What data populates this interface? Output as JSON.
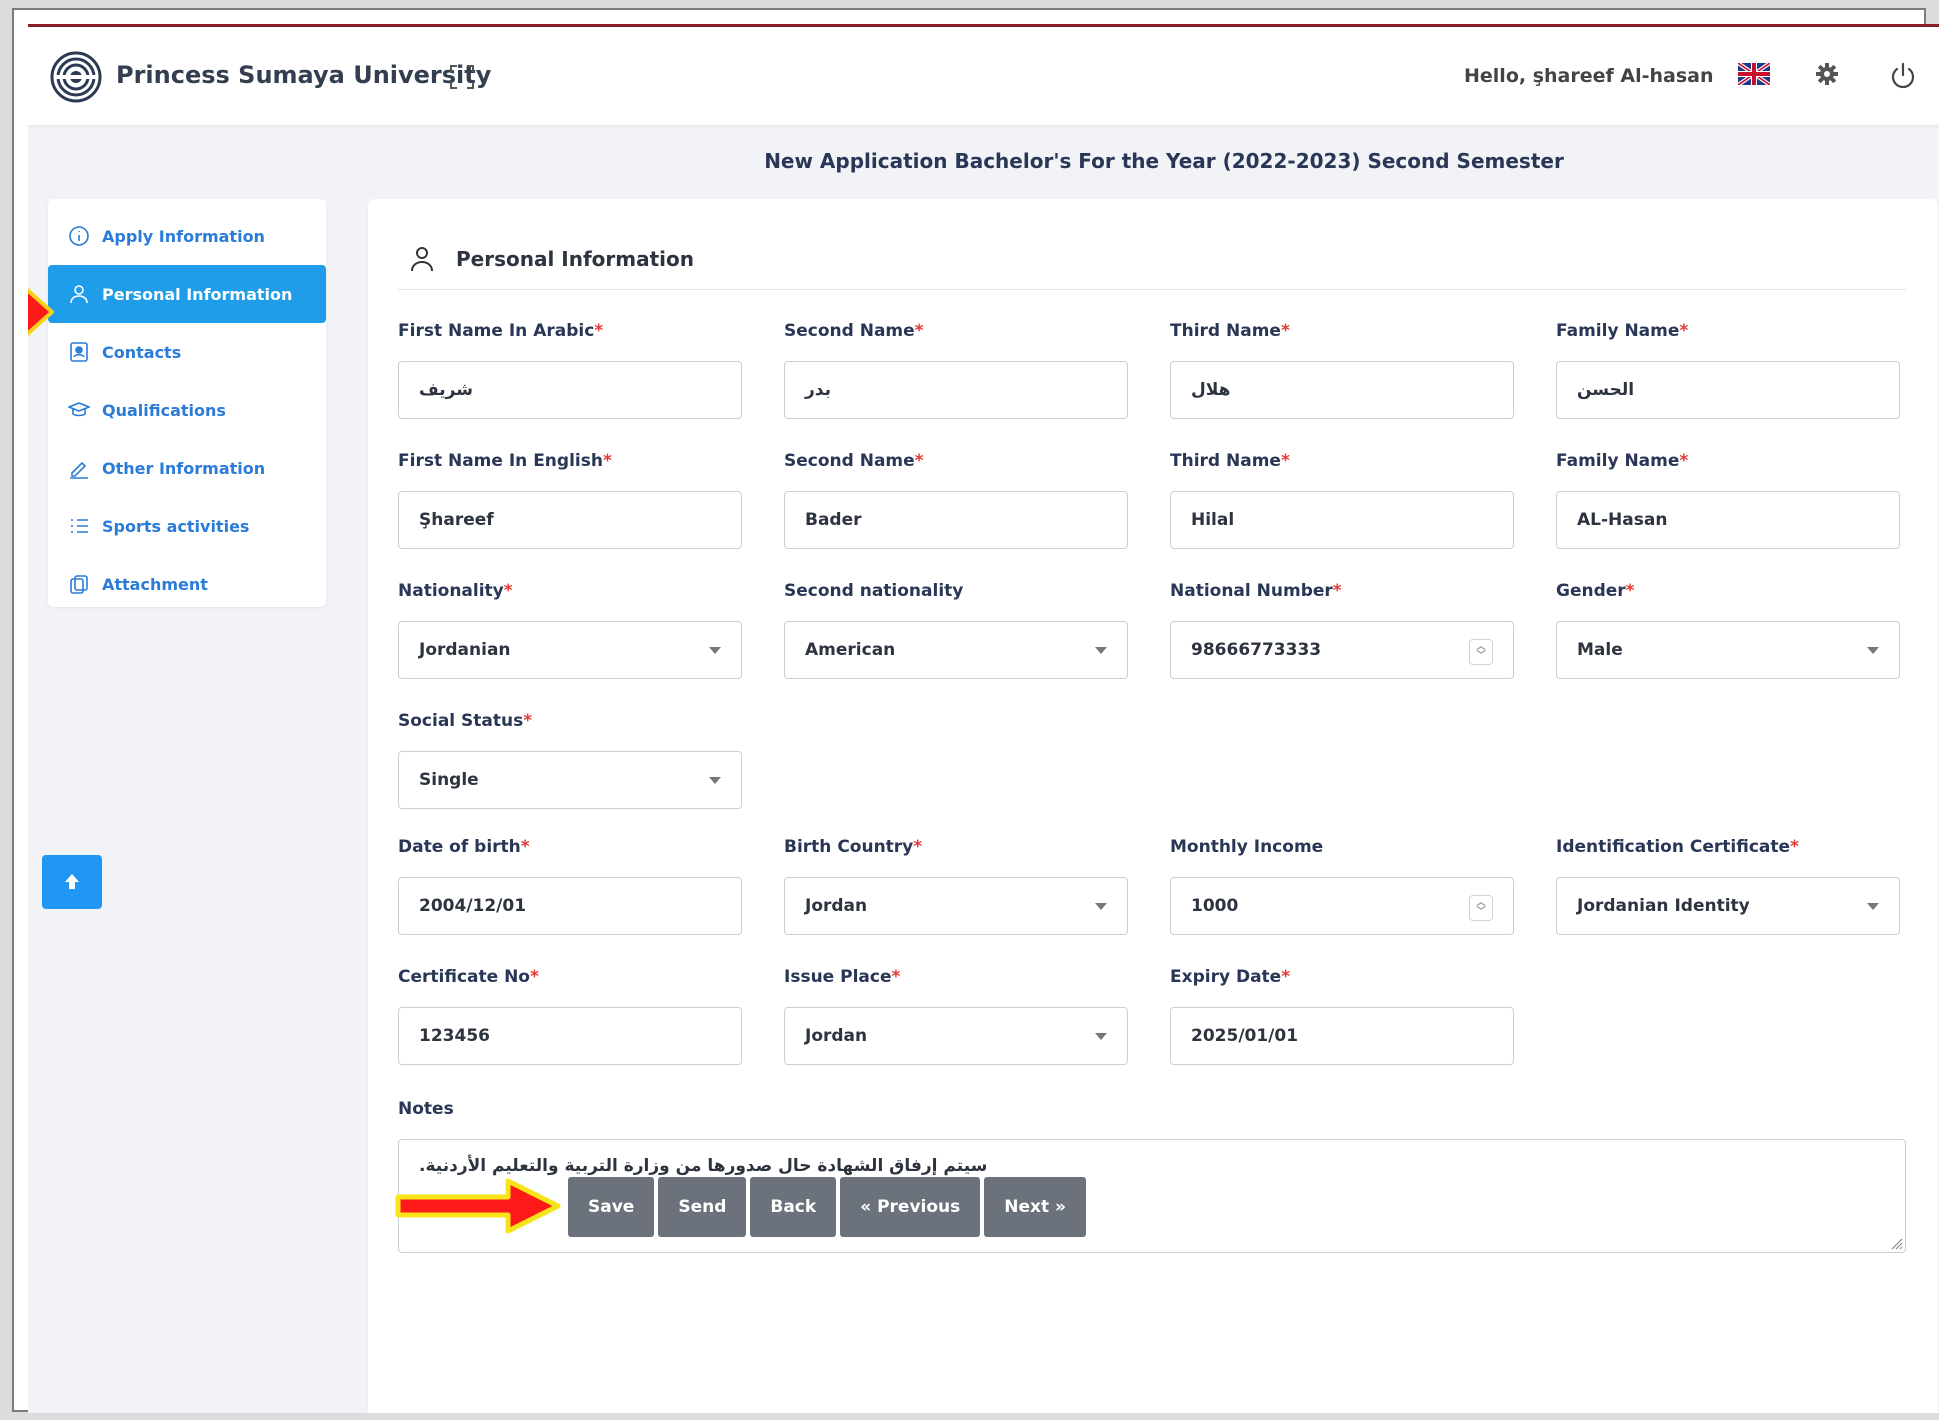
{
  "header": {
    "university_name": "Princess Sumaya University",
    "greeting": "Hello, şhareef Al-hasan",
    "icons": [
      "university-logo-icon",
      "expand-icon",
      "uk-flag-icon",
      "gear-icon",
      "power-icon"
    ]
  },
  "page_title": "New Application Bachelor's For the Year (2022-2023) Second Semester",
  "sidebar": {
    "items": [
      {
        "label": "Apply Information",
        "icon": "info-icon",
        "active": false
      },
      {
        "label": "Personal Information",
        "icon": "user-icon",
        "active": true
      },
      {
        "label": "Contacts",
        "icon": "contact-card-icon",
        "active": false
      },
      {
        "label": "Qualifications",
        "icon": "graduation-cap-icon",
        "active": false
      },
      {
        "label": "Other Information",
        "icon": "pencil-icon",
        "active": false
      },
      {
        "label": "Sports activities",
        "icon": "list-icon",
        "active": false
      },
      {
        "label": "Attachment",
        "icon": "copy-icon",
        "active": false
      }
    ]
  },
  "section": {
    "title": "Personal Information",
    "icon": "user-icon"
  },
  "form": {
    "first_name_ar": {
      "label": "First Name In Arabic",
      "value": "شريف"
    },
    "second_name_ar": {
      "label": "Second Name",
      "value": "بدر"
    },
    "third_name_ar": {
      "label": "Third Name",
      "value": "هلال"
    },
    "family_name_ar": {
      "label": "Family Name",
      "value": "الحسن"
    },
    "first_name_en": {
      "label": "First Name In English",
      "value": "Şhareef"
    },
    "second_name_en": {
      "label": "Second Name",
      "value": "Bader"
    },
    "third_name_en": {
      "label": "Third Name",
      "value": "Hilal"
    },
    "family_name_en": {
      "label": "Family Name",
      "value": "AL-Hasan"
    },
    "nationality": {
      "label": "Nationality",
      "value": "Jordanian"
    },
    "second_nationality": {
      "label": "Second nationality",
      "value": "American"
    },
    "national_number": {
      "label": "National Number",
      "value": "98666773333"
    },
    "gender": {
      "label": "Gender",
      "value": "Male"
    },
    "social_status": {
      "label": "Social Status",
      "value": "Single"
    },
    "date_of_birth": {
      "label": "Date of birth",
      "value": "2004/12/01"
    },
    "birth_country": {
      "label": "Birth Country",
      "value": "Jordan"
    },
    "monthly_income": {
      "label": "Monthly Income",
      "value": "1000"
    },
    "identification_certificate": {
      "label": "Identification Certificate",
      "value": "Jordanian Identity"
    },
    "certificate_no": {
      "label": "Certificate No",
      "value": "123456"
    },
    "issue_place": {
      "label": "Issue Place",
      "value": "Jordan"
    },
    "expiry_date": {
      "label": "Expiry Date",
      "value": "2025/01/01"
    },
    "notes": {
      "label": "Notes",
      "value": ".سيتم إرفاق الشهادة حال صدورها من وزارة التربية والتعليم الأردنية"
    }
  },
  "buttons": {
    "save": "Save",
    "send": "Send",
    "back": "Back",
    "previous": "« Previous",
    "next": "Next »"
  },
  "colors": {
    "accent": "#1f9de8",
    "link": "#2b7bd8",
    "title": "#2a3656",
    "required": "#e53935",
    "button": "#6c727c",
    "top_border": "#8b1e2b",
    "annotation_arrow": "#ff1a1a"
  }
}
